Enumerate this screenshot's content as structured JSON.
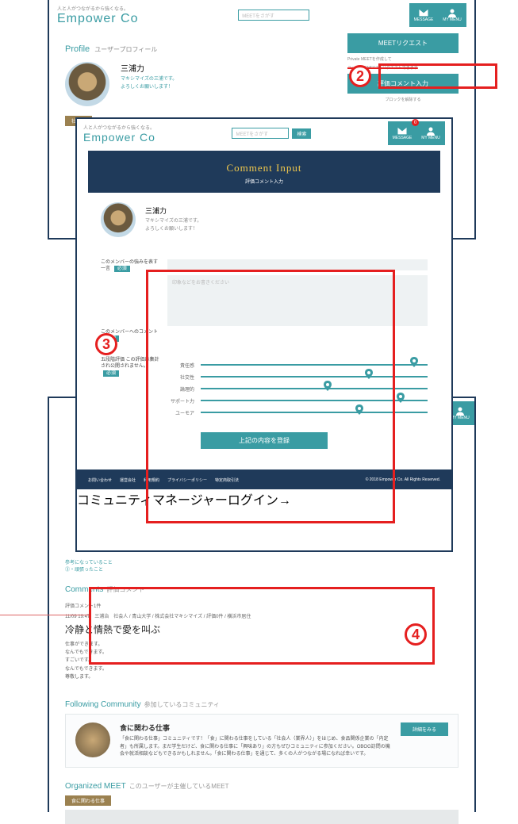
{
  "brand": {
    "tagline": "人と人がつながるから強くなる。",
    "name": "Empower Co"
  },
  "nav": {
    "search_placeholder": "MEETをさがす",
    "message_label": "MESSAGE",
    "mymenu_label": "MY MENU",
    "badge_count": "0"
  },
  "sec1": {
    "title": "Profile",
    "subtitle": "ユーザープロフィール",
    "name": "三浦力",
    "bio1": "マキシマイズの三浦です。",
    "bio2": "よろしくお願いします！",
    "role_tag": "社会人",
    "btn_meet": "MEETリクエスト",
    "note_private": "Private MEETを作成して",
    "note_user": "ユーザーにMEETをリクエストできます",
    "btn_comment": "評価コメント入力",
    "btn_block": "ブロックを解除する"
  },
  "sec2": {
    "hero_title": "Comment Input",
    "hero_sub": "評価コメント入力",
    "name": "三浦力",
    "bio1": "マキシマイズの三浦です。",
    "bio2": "よろしくお願いします！",
    "field_strength": "このメンバーの強みを表す一言",
    "field_comment": "このメンバーへのコメント",
    "req": "必須",
    "ph_strength": "",
    "ph_comment": "印象などをお書きください",
    "rating_label": "五段階評価 この評価は集計され公開されません。",
    "sliders": [
      {
        "label": "責任感",
        "pos": 0.94
      },
      {
        "label": "社交性",
        "pos": 0.74
      },
      {
        "label": "論理的",
        "pos": 0.56
      },
      {
        "label": "サポート力",
        "pos": 0.88
      },
      {
        "label": "ユーモア",
        "pos": 0.7
      }
    ],
    "submit": "上記の内容を登録",
    "footer_links": [
      "お問い合わせ",
      "運営会社",
      "利用規約",
      "プライバシーポリシー",
      "特定商取引法"
    ],
    "footer_mgr": "コミュニティマネージャーログイン→",
    "footer_copy": "© 2018 Empower Co. All Rights Reserved."
  },
  "sec3": {
    "tiny1": "参考になっていること",
    "tiny2": "③・頑張ったこと",
    "comments_title": "Comments",
    "comments_sub": "評価コメント",
    "count_line": "評価コメント1件",
    "meta": "11/09 19:47　三浦治　社会人 / 青山大学 / 株式会社マキシマイズ / 評価0件 / 横浜市居住",
    "cm_title": "冷静と情熱で愛を叫ぶ",
    "cm_body": [
      "仕事ができます。",
      "なんでもできます。",
      "すごいです。",
      "なんでもできます。",
      "尊敬します。"
    ],
    "follow_title": "Following Community",
    "follow_sub": "参加しているコミュニティ",
    "comm_name": "食に関わる仕事",
    "comm_body": "「食に関わる仕事」コミュニティです！「食」に関わる仕事をしている「社会人（業界人）」をはじめ、食品関係企業の「内定者」も所属します。まだ学生だけど、食に関わる仕事に「興味あり」の方もぜひコミュニティに参加ください。OBOG訪問の機会や就活相談などもできるかもしれません。「食に関わる仕事」を通じて、多くの人がつながる場になれば幸いです。",
    "comm_more": "詳細をみる",
    "org_title": "Organized MEET",
    "org_sub": "このユーザーが主催しているMEET",
    "org_tag": "食に関わる仕事"
  },
  "callouts": {
    "c2": "2",
    "c3": "3",
    "c4": "4"
  }
}
